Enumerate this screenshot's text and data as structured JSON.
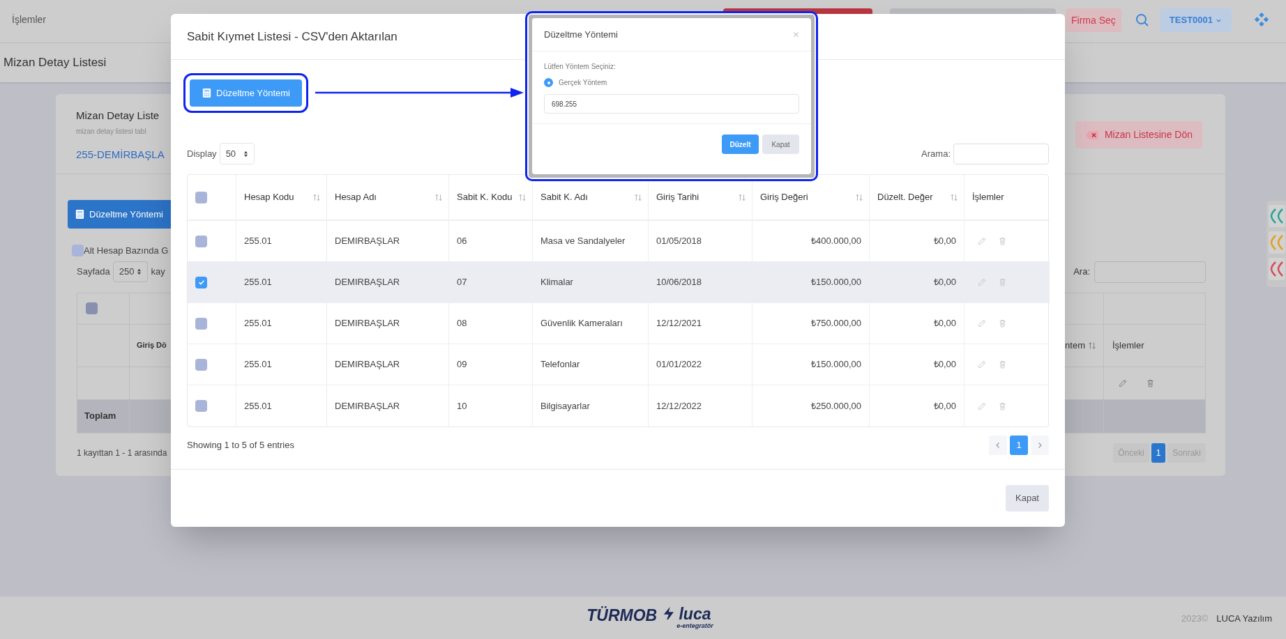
{
  "top_bar": {
    "menu": "İşlemler",
    "company_button": "Firma Seç",
    "user_button": "TEST0001"
  },
  "page_title": "Mizan Detay Listesi",
  "background": {
    "title": "Mizan Detay Liste",
    "subtitle": "mizan detay listesi tabl",
    "account": "255-DEMİRBAŞLA",
    "back_button": "Mizan Listesine Dön",
    "adjust_button": "Düzeltme Yöntemi",
    "sub_account": {
      "label": "Alt Hesap Bazında G",
      "checked": false
    },
    "page_size_label": "Sayfada",
    "page_size": "250",
    "page_size_suffix": "kay",
    "search_label": "Ara:",
    "select_all": {
      "checked": false
    },
    "header_left": "Giriş Dö",
    "header_right": "ntem",
    "header_actions": "İşlemler",
    "total_label": "Toplam",
    "info": "1 kayıttan 1 - 1 arasında",
    "pagination": [
      {
        "label": "Önceki",
        "selected": false
      },
      {
        "label": "1",
        "selected": true
      },
      {
        "label": "Sonraki",
        "selected": false
      }
    ]
  },
  "modal": {
    "title": "Sabit Kıymet Listesi - CSV'den Aktarılan",
    "adjust_button": "Düzeltme Yöntemi",
    "display_label": "Display",
    "display_value": "50",
    "search_label": "Arama:",
    "select_all": {
      "checked": false
    },
    "columns": [
      {
        "kind": "text",
        "label": "Hesap Kodu"
      },
      {
        "kind": "text",
        "label": "Hesap Adı"
      },
      {
        "kind": "text",
        "label": "Sabit K. Kodu"
      },
      {
        "kind": "text",
        "label": "Sabit K. Adı"
      },
      {
        "kind": "text",
        "label": "Giriş Tarihi"
      },
      {
        "kind": "amount",
        "label": "Giriş Değeri"
      },
      {
        "kind": "amount",
        "label": "Düzelt. Değer"
      },
      {
        "kind": "actions",
        "label": "İşlemler"
      }
    ],
    "rows": [
      {
        "selected": false,
        "cells": [
          "255.01",
          "DEMIRBAŞLAR",
          "06",
          "Masa ve Sandalyeler",
          "01/05/2018",
          "₺400.000,00",
          "₺0,00"
        ]
      },
      {
        "selected": true,
        "cells": [
          "255.01",
          "DEMIRBAŞLAR",
          "07",
          "Klimalar",
          "10/06/2018",
          "₺150.000,00",
          "₺0,00"
        ]
      },
      {
        "selected": false,
        "cells": [
          "255.01",
          "DEMIRBAŞLAR",
          "08",
          "Güvenlik Kameraları",
          "12/12/2021",
          "₺750.000,00",
          "₺0,00"
        ]
      },
      {
        "selected": false,
        "cells": [
          "255.01",
          "DEMIRBAŞLAR",
          "09",
          "Telefonlar",
          "01/01/2022",
          "₺150.000,00",
          "₺0,00"
        ]
      },
      {
        "selected": false,
        "cells": [
          "255.01",
          "DEMIRBAŞLAR",
          "10",
          "Bilgisayarlar",
          "12/12/2022",
          "₺250.000,00",
          "₺0,00"
        ]
      }
    ],
    "showing": "Showing 1 to 5 of 5 entries",
    "pages": [
      {
        "label": "1",
        "selected": true
      }
    ],
    "close_button": "Kapat"
  },
  "adjust_dialog": {
    "title": "Düzeltme Yöntemi",
    "prompt": "Lütfen Yöntem Seçiniz:",
    "options": [
      {
        "label": "Gerçek Yöntem",
        "selected": true
      }
    ],
    "value": "698.255",
    "buttons": [
      {
        "kind": "primary",
        "label": "Düzelt"
      },
      {
        "kind": "secondary",
        "label": "Kapat"
      }
    ]
  },
  "footer": {
    "brand": "TÜRMOB",
    "product": "luca",
    "tagline": "e-entegratör",
    "year": "2023©",
    "company": "LUCA Yazılım"
  }
}
